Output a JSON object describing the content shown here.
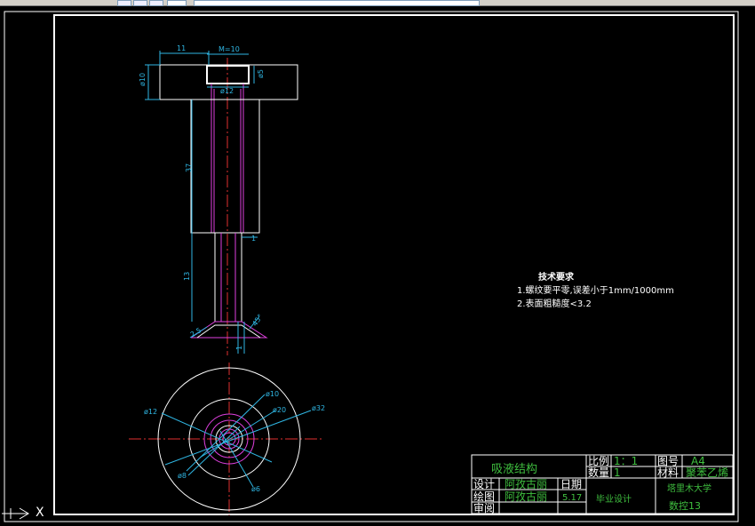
{
  "dimensions": {
    "d10": "ø10",
    "len11": "11",
    "m10": "M=10",
    "d5": "ø5",
    "d12_top": "ø12",
    "len37": "37",
    "len13": "13",
    "len1": "1",
    "angle": "45°",
    "bottom_r": "2.5",
    "bottom_1": "1",
    "c_d12": "ø12",
    "c_d10": "ø10",
    "c_d20": "ø20",
    "c_d32": "ø32",
    "c_d8": "ø8",
    "c_d6": "ø6"
  },
  "tech_notes": {
    "title": "技术要求",
    "line1": "1.螺纹要平零,误差小于1mm/1000mm",
    "line2": "2.表面粗糙度<3.2"
  },
  "title_block": {
    "part_name": "吸液结构",
    "scale_label": "比例",
    "scale_value": "1：1",
    "drawing_no_label": "图号",
    "drawing_no_value": "A4",
    "qty_label": "数量",
    "qty_value": "1",
    "material_label": "材料",
    "material_value": "聚苯乙烯",
    "design_label": "设计",
    "design_value": "阿孜古丽",
    "draw_label": "绘图",
    "draw_value": "阿孜古丽",
    "review_label": "审阅",
    "date_label": "日期",
    "date_value": "5.17",
    "project": "毕业设计",
    "school": "塔里木大学",
    "class": "数控13"
  },
  "ucs": {
    "label": "X"
  },
  "colors": {
    "background": "#000000",
    "border": "#ffffff",
    "part_outline": "#ffffff",
    "dimension": "#2fb6e3",
    "center_line": "#e03030",
    "thread": "#e040e0",
    "text_green": "#3fbf3f"
  }
}
